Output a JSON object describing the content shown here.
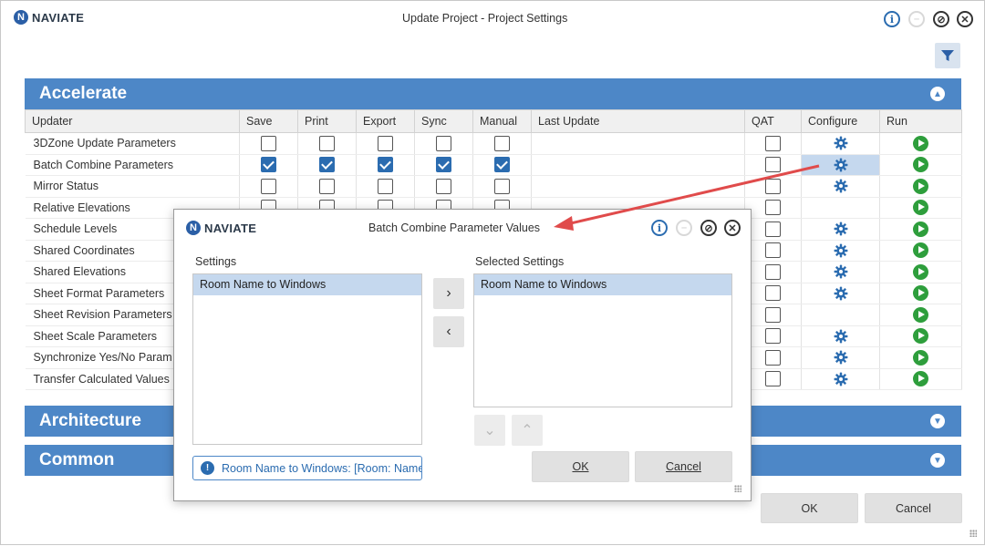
{
  "app": {
    "logo_text": "NAVIATE",
    "window_title": "Update Project - Project Settings"
  },
  "sections": {
    "accelerate": "Accelerate",
    "architecture": "Architecture",
    "common": "Common"
  },
  "table": {
    "headers": [
      "Updater",
      "Save",
      "Print",
      "Export",
      "Sync",
      "Manual",
      "Last Update",
      "QAT",
      "Configure",
      "Run"
    ],
    "rows": [
      {
        "name": "3DZone Update Parameters",
        "save": false,
        "print": false,
        "export": false,
        "sync": false,
        "manual": false,
        "qat": false,
        "configure": true,
        "run": true
      },
      {
        "name": "Batch Combine Parameters",
        "save": true,
        "print": true,
        "export": true,
        "sync": true,
        "manual": true,
        "qat": false,
        "configure": true,
        "run": true
      },
      {
        "name": "Mirror Status",
        "save": false,
        "print": false,
        "export": false,
        "sync": false,
        "manual": false,
        "qat": false,
        "configure": true,
        "run": true
      },
      {
        "name": "Relative Elevations",
        "save": false,
        "print": false,
        "export": false,
        "sync": false,
        "manual": false,
        "qat": false,
        "configure": false,
        "run": true
      },
      {
        "name": "Schedule Levels",
        "qat": false,
        "configure": true,
        "run": true
      },
      {
        "name": "Shared Coordinates",
        "qat": false,
        "configure": true,
        "run": true
      },
      {
        "name": "Shared Elevations",
        "qat": false,
        "configure": true,
        "run": true
      },
      {
        "name": "Sheet Format Parameters",
        "qat": false,
        "configure": true,
        "run": true
      },
      {
        "name": "Sheet Revision Parameters",
        "qat": false,
        "configure": false,
        "run": true
      },
      {
        "name": "Sheet Scale Parameters",
        "qat": false,
        "configure": true,
        "run": true
      },
      {
        "name": "Synchronize Yes/No Param",
        "qat": false,
        "configure": true,
        "run": true
      },
      {
        "name": "Transfer Calculated Values",
        "qat": false,
        "configure": true,
        "run": true
      }
    ]
  },
  "buttons": {
    "ok": "OK",
    "cancel": "Cancel"
  },
  "dialog": {
    "logo_text": "NAVIATE",
    "title": "Batch Combine Parameter Values",
    "settings_label": "Settings",
    "selected_label": "Selected Settings",
    "settings_items": [
      "Room Name to Windows"
    ],
    "selected_items": [
      "Room Name to Windows"
    ],
    "status_text": "Room Name to Windows: [Room: Name]",
    "ok_label": "OK",
    "cancel_label": "Cancel"
  },
  "colors": {
    "section_blue": "#4d87c7",
    "checkbox_blue": "#2b6cb0",
    "run_green": "#2e9e3c",
    "annotation_red": "#e04b4b"
  },
  "icons": [
    "info-icon",
    "minimize-icon",
    "restore-icon",
    "close-icon",
    "filter-icon",
    "gear-icon",
    "run-icon",
    "chevron-up-icon",
    "chevron-down-icon"
  ]
}
